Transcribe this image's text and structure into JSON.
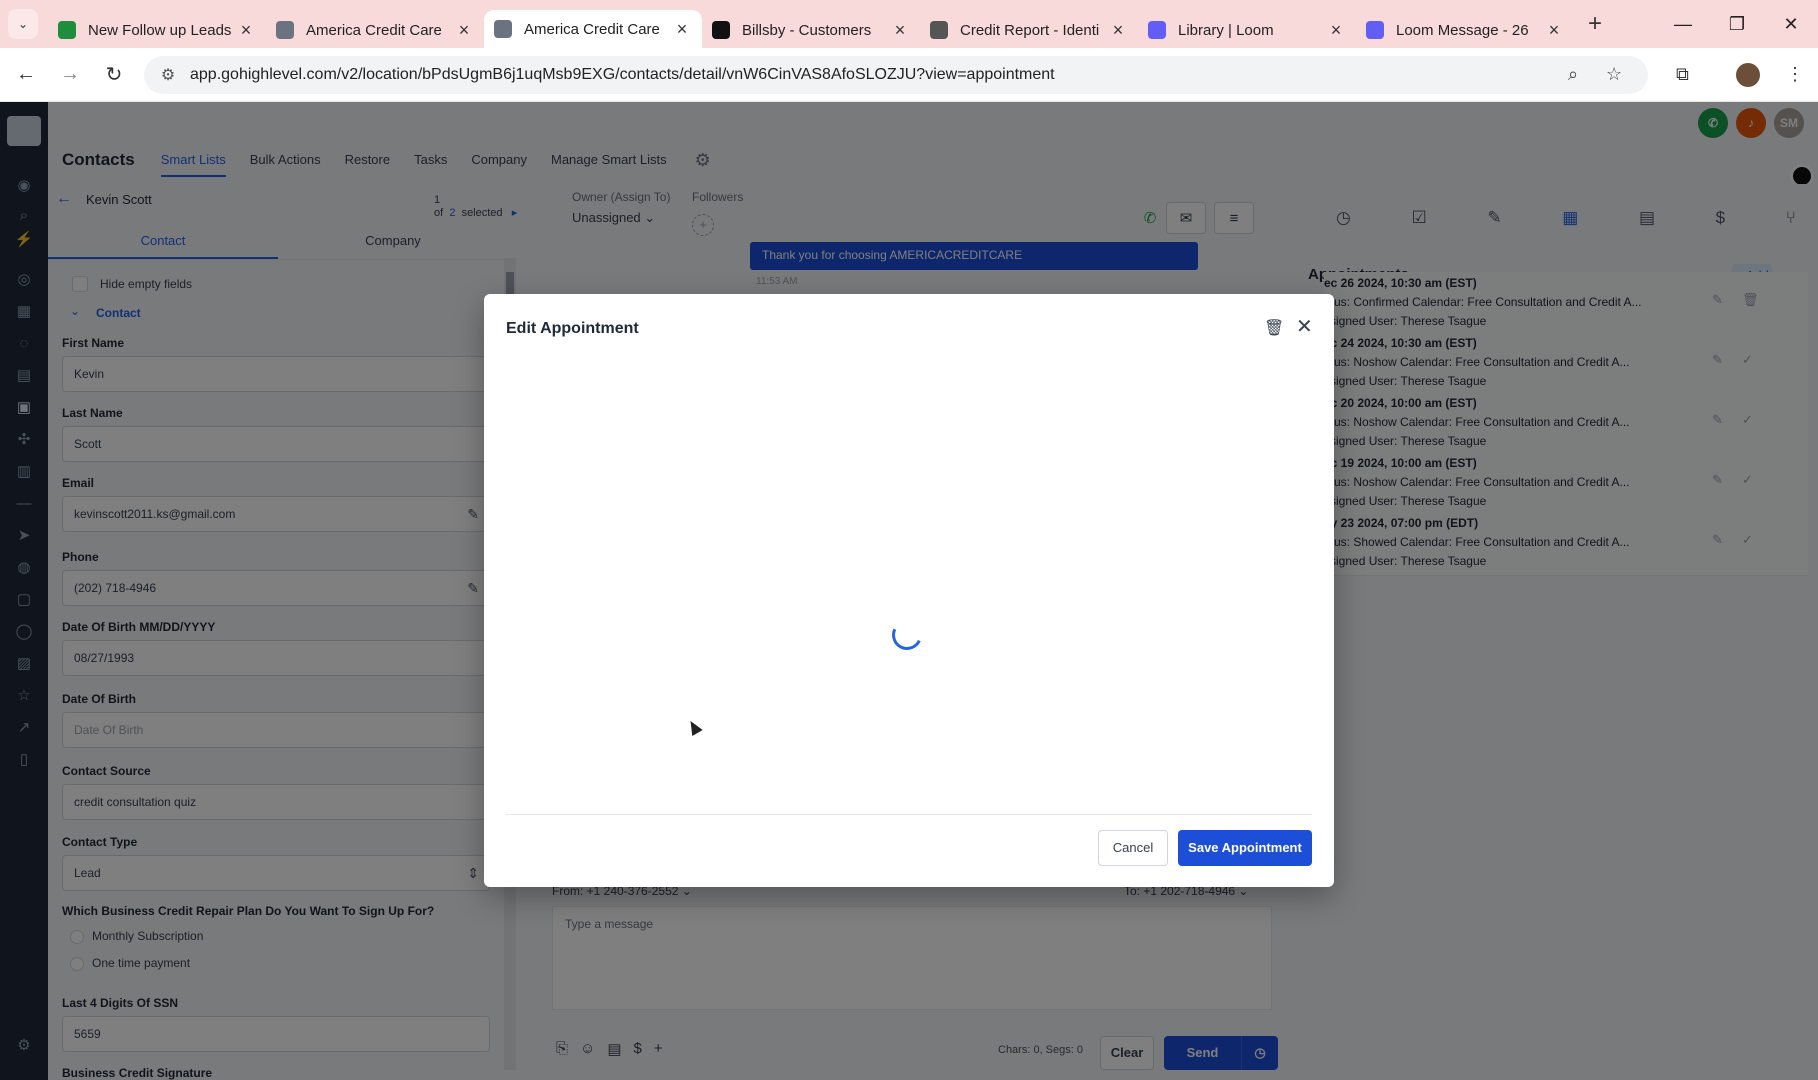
{
  "browser": {
    "tabs": [
      {
        "title": "New Follow up Leads",
        "icon": "sheets-icon",
        "color": "#1e8e3e"
      },
      {
        "title": "America Credit Care",
        "icon": "acc-logo-icon",
        "color": "#6b7280"
      },
      {
        "title": "America Credit Care",
        "icon": "acc-logo-icon",
        "color": "#6b7280",
        "active": true
      },
      {
        "title": "Billsby - Customers",
        "icon": "billsby-icon",
        "color": "#111111"
      },
      {
        "title": "Credit Report - Identi",
        "icon": "globe-icon",
        "color": "#555555"
      },
      {
        "title": "Library | Loom",
        "icon": "loom-icon",
        "color": "#625df5"
      },
      {
        "title": "Loom Message - 26",
        "icon": "loom-icon",
        "color": "#625df5"
      }
    ],
    "url": "app.gohighlevel.com/v2/location/bPdsUgmB6j1uqMsb9EXG/contacts/detail/vnW6CinVAS8AfoSLOZJU?view=appointment"
  },
  "header": {
    "title": "Contacts",
    "tabs": [
      "Smart Lists",
      "Bulk Actions",
      "Restore",
      "Tasks",
      "Company",
      "Manage Smart Lists"
    ],
    "avatar_initials": "SM"
  },
  "contact_panel": {
    "name": "Kevin Scott",
    "selection": {
      "pre": "1 of",
      "count": "2",
      "post": "selected"
    },
    "tabs": [
      "Contact",
      "Company"
    ],
    "hide_empty": "Hide empty fields",
    "section": "Contact",
    "fields": {
      "first_name": {
        "label": "First Name",
        "value": "Kevin"
      },
      "last_name": {
        "label": "Last Name",
        "value": "Scott"
      },
      "email": {
        "label": "Email",
        "value": "kevinscott2011.ks@gmail.com"
      },
      "phone": {
        "label": "Phone",
        "value": "(202) 718-4946"
      },
      "dob_mm": {
        "label": "Date Of Birth MM/DD/YYYY",
        "value": "08/27/1993"
      },
      "dob": {
        "label": "Date Of Birth",
        "placeholder": "Date Of Birth"
      },
      "source": {
        "label": "Contact Source",
        "value": "credit consultation quiz"
      },
      "type": {
        "label": "Contact Type",
        "value": "Lead"
      },
      "plan": {
        "label": "Which Business Credit Repair Plan Do You Want To Sign Up For?",
        "options": [
          "Monthly Subscription",
          "One time payment"
        ]
      },
      "ssn": {
        "label": "Last 4 Digits Of SSN",
        "value": "5659"
      },
      "signature": {
        "label": "Business Credit Signature"
      }
    }
  },
  "conversation": {
    "owner_label": "Owner (Assign To)",
    "owner_value": "Unassigned",
    "followers_label": "Followers",
    "message": "Thank you for choosing AMERICACREDITCARE",
    "message_time": "11:53 AM",
    "from": "From:   +1 240-376-2552",
    "to": "To:   +1 202-718-4946",
    "placeholder": "Type a message",
    "chars": "Chars: 0, Segs: 0",
    "clear": "Clear",
    "send": "Send"
  },
  "appointments": {
    "title": "Appointments",
    "add": "+ Add",
    "items": [
      {
        "date": "ec 26 2024, 10:30 am (EST)",
        "status": "atus: Confirmed     Calendar: Free Consultation and Credit A...",
        "user": "ssigned User: Therese Tsague",
        "icon2": "🗑"
      },
      {
        "date": "ec 24 2024, 10:30 am (EST)",
        "status": "atus: Noshow     Calendar: Free Consultation and Credit A...",
        "user": "ssigned User: Therese Tsague",
        "icon2": "✓"
      },
      {
        "date": "ec 20 2024, 10:00 am (EST)",
        "status": "atus: Noshow     Calendar: Free Consultation and Credit A...",
        "user": "ssigned User: Therese Tsague",
        "icon2": "✓"
      },
      {
        "date": "ec 19 2024, 10:00 am (EST)",
        "status": "atus: Noshow     Calendar: Free Consultation and Credit A...",
        "user": "ssigned User: Therese Tsague",
        "icon2": "✓"
      },
      {
        "date": "ay 23 2024, 07:00 pm (EDT)",
        "status": "atus: Showed     Calendar: Free Consultation and Credit A...",
        "user": "ssigned User: Therese Tsague",
        "icon2": "✓"
      }
    ]
  },
  "modal": {
    "title": "Edit Appointment",
    "cancel": "Cancel",
    "save": "Save Appointment"
  },
  "colors": {
    "accent": "#1d4ed8",
    "tabbar": "#f8dada",
    "sidebar": "#1e293b"
  }
}
